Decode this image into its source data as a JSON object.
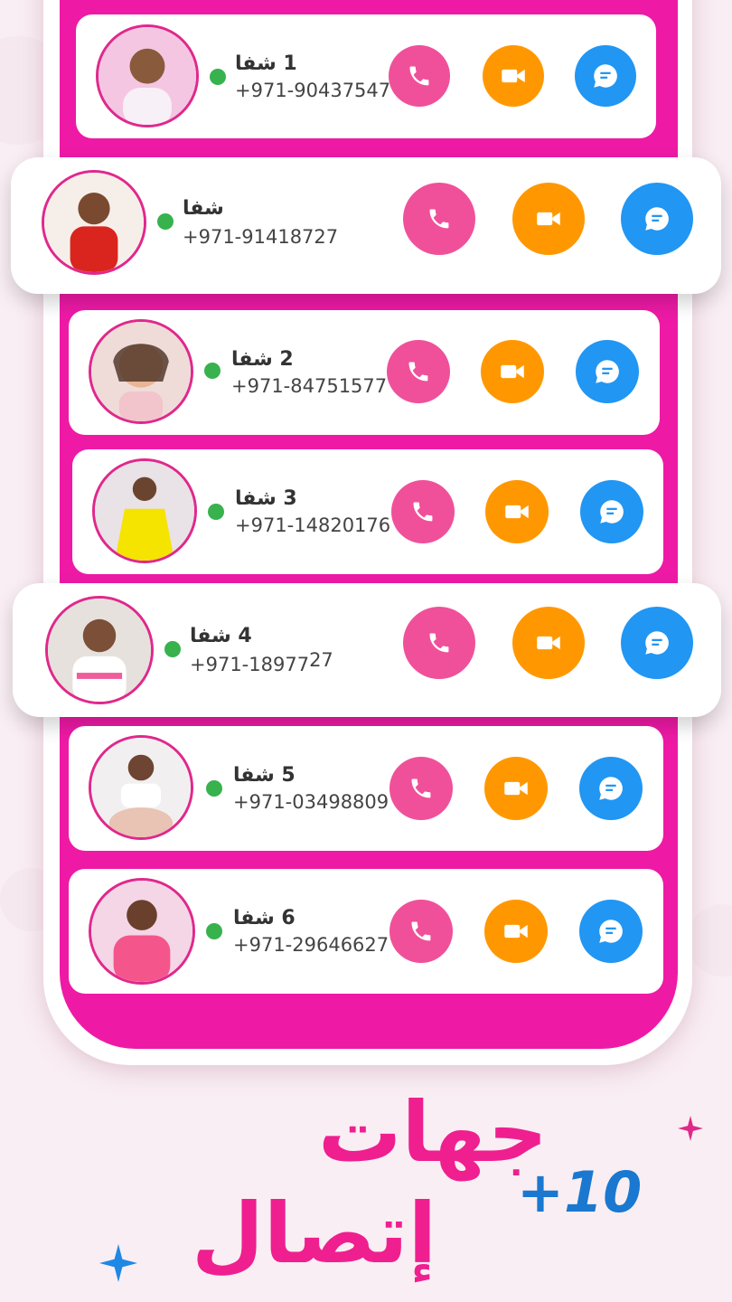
{
  "colors": {
    "accent_pink": "#ee1aa6",
    "call": "#f0509a",
    "video": "#ff9800",
    "chat": "#2196f3",
    "online": "#37b24d"
  },
  "contacts": [
    {
      "name": "1 شفا",
      "phone": "+971-90437547"
    },
    {
      "name": "شفا",
      "phone": "+971-91418727"
    },
    {
      "name": "2 شفا",
      "phone": "+971-84751577"
    },
    {
      "name": "3 شفا",
      "phone": "+971-14820176"
    },
    {
      "name": "4 شفا",
      "phone": "+971-18977",
      "phone_suffix": "27"
    },
    {
      "name": "5 شفا",
      "phone": "+971-03498809"
    },
    {
      "name": "6 شفا",
      "phone": "+971-29646627"
    }
  ],
  "icons": {
    "call": "phone-icon",
    "video": "video-camera-icon",
    "chat": "chat-bubble-icon"
  },
  "promo": {
    "line1": "جهات",
    "line2": "إتصال",
    "count": "+10"
  }
}
